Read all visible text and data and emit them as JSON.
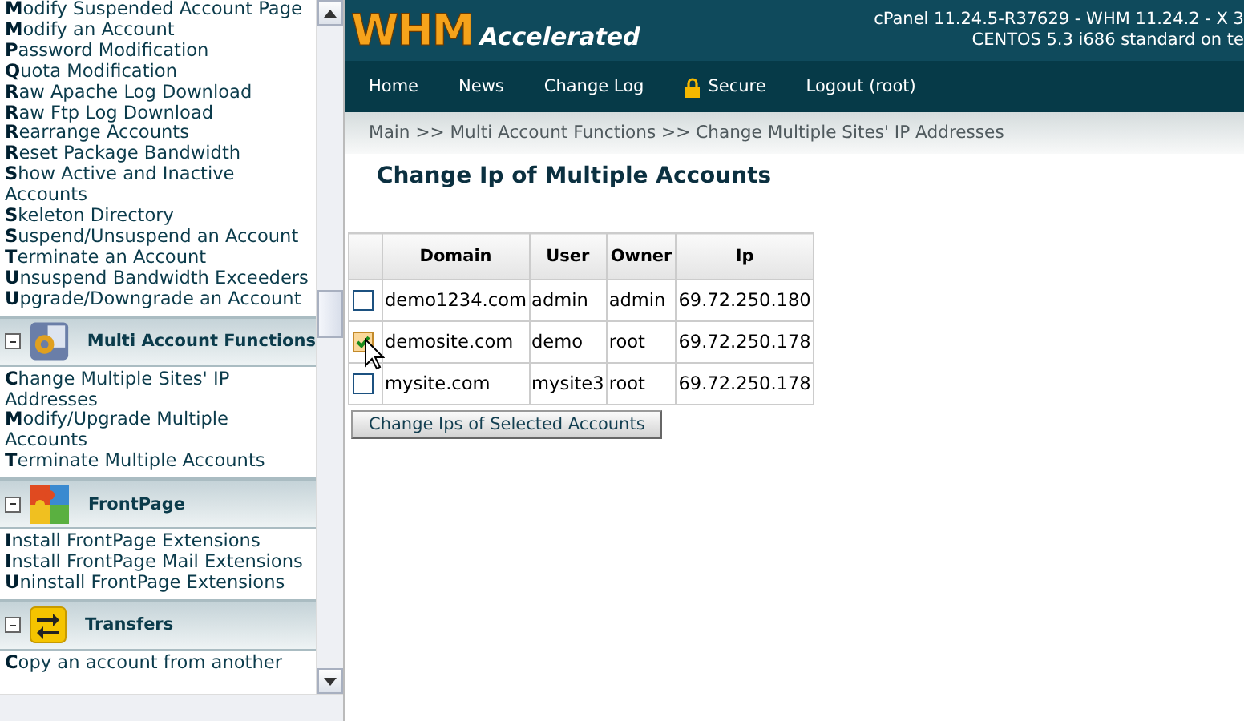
{
  "sidebar": {
    "groups": [
      {
        "items": [
          "**M**odify Suspended Account Page",
          "**M**odify an Account",
          "**P**assword Modification",
          "**Q**uota Modification",
          "**R**aw Apache Log Download",
          "**R**aw Ftp Log Download",
          "**R**earrange Accounts",
          "**R**eset Package Bandwidth",
          "**S**how Active and Inactive Accounts",
          "**S**keleton Directory",
          "**S**uspend/Unsuspend an Account",
          "**T**erminate an Account",
          "**U**nsuspend Bandwidth Exceeders",
          "**U**pgrade/Downgrade an Account"
        ]
      },
      {
        "heading": "Multi Account Functions",
        "kind": "gear",
        "items": [
          "**C**hange Multiple Sites' IP Addresses",
          "**M**odify/Upgrade Multiple Accounts",
          "**T**erminate Multiple Accounts"
        ]
      },
      {
        "heading": "FrontPage",
        "kind": "puzzle",
        "items": [
          "**I**nstall FrontPage Extensions",
          "**I**nstall FrontPage Mail Extensions",
          "**U**ninstall FrontPage Extensions"
        ]
      },
      {
        "heading": "Transfers",
        "kind": "arrows",
        "items": [
          "**C**opy an account from another"
        ]
      }
    ]
  },
  "header": {
    "logo_main": "WHM",
    "logo_sub": "Accelerated",
    "version": "cPanel 11.24.5-R37629 - WHM 11.24.2 - X 3",
    "system": "CENTOS 5.3 i686 standard on te"
  },
  "nav": [
    {
      "label": "Home"
    },
    {
      "label": "News"
    },
    {
      "label": "Change Log"
    },
    {
      "label": "Secure",
      "kind": "secure"
    },
    {
      "label": "Logout (root)"
    }
  ],
  "breadcrumb": "Main >> Multi Account Functions >> Change Multiple Sites' IP Addresses",
  "title": "Change Ip of Multiple Accounts",
  "table": {
    "columns": [
      "Domain",
      "User",
      "Owner",
      "Ip"
    ],
    "rows": [
      {
        "checked": false,
        "domain": "demo1234.com",
        "user": "admin",
        "owner": "admin",
        "ip": "69.72.250.180"
      },
      {
        "checked": true,
        "domain": "demosite.com",
        "user": "demo",
        "owner": "root",
        "ip": "69.72.250.178"
      },
      {
        "checked": false,
        "domain": "mysite.com",
        "user": "mysite3",
        "owner": "root",
        "ip": "69.72.250.178"
      }
    ]
  },
  "submit": "Change Ips of Selected Accounts"
}
